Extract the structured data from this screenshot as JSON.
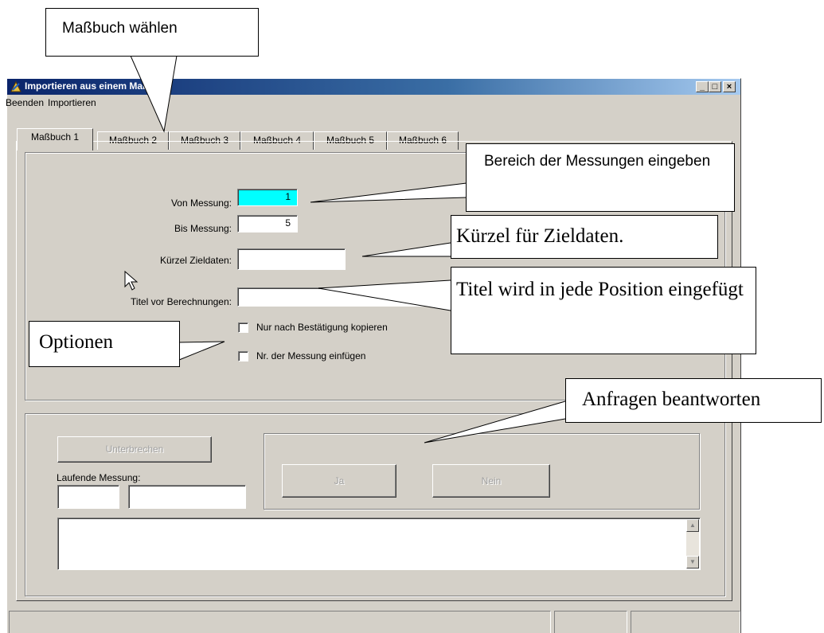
{
  "window": {
    "title": "Importieren aus einem Maßbuch",
    "caption_buttons": {
      "minimize": "_",
      "maximize": "□",
      "close": "×"
    }
  },
  "menu": {
    "items": [
      "Beenden",
      "Importieren"
    ]
  },
  "tabs": [
    "Maßbuch 1",
    "Maßbuch 2",
    "Maßbuch 3",
    "Maßbuch 4",
    "Maßbuch 5",
    "Maßbuch 6"
  ],
  "active_tab": "Maßbuch 1",
  "form": {
    "von_label": "Von Messung:",
    "von_value": "1",
    "bis_label": "Bis Messung:",
    "bis_value": "5",
    "kuerzel_label": "Kürzel Zieldaten:",
    "kuerzel_value": "",
    "titel_label": "Titel vor Berechnungen:",
    "titel_value": "",
    "option1_label": "Nur nach Bestätigung kopieren",
    "option2_label": "Nr. der Messung einfügen"
  },
  "run": {
    "interrupt_label": "Unterbrechen",
    "current_label": "Laufende Messung:",
    "yes_label": "Ja",
    "no_label": "Nein",
    "scroll_up": "▲",
    "scroll_down": "▼"
  },
  "callouts": {
    "select_book": "Maßbuch wählen",
    "range": "Bereich der Messungen eingeben",
    "kuerzel": "Kürzel für Zieldaten.",
    "titel": "Titel wird in jede Position eingefügt",
    "optionen": "Optionen",
    "anfragen": "Anfragen beantworten"
  },
  "colors": {
    "selected_field": "#00ffff",
    "window_bg": "#d4d0c8",
    "title_start": "#0a246a",
    "title_end": "#a6caf0"
  }
}
